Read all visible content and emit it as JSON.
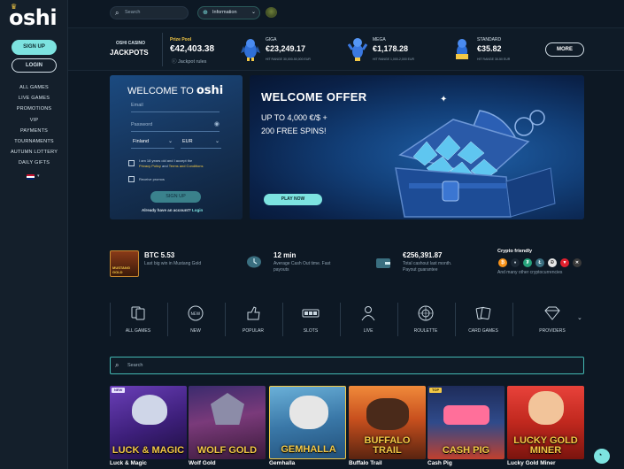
{
  "brand": {
    "logo_text": "oshi"
  },
  "sidebar": {
    "signup_label": "SIGN UP",
    "login_label": "LOGIN",
    "items": [
      {
        "label": "ALL GAMES"
      },
      {
        "label": "LIVE GAMES"
      },
      {
        "label": "PROMOTIONS"
      },
      {
        "label": "VIP"
      },
      {
        "label": "PAYMENTS"
      },
      {
        "label": "TOURNAMENTS"
      },
      {
        "label": "AUTUMN LOTTERY"
      },
      {
        "label": "DAILY GIFTS"
      }
    ],
    "language": "EN"
  },
  "topbar": {
    "search_placeholder": "Search",
    "info_label": "Information"
  },
  "jackpots": {
    "brand_line1": "OSHI CASINO",
    "brand_line2": "JACKPOTS",
    "prize_label": "Prize Pool",
    "prize_value": "€42,403.38",
    "rules_label": "Jackpot rules",
    "tiers": [
      {
        "name": "GIGA",
        "amount": "€23,249.17",
        "hit_range": "HIT RANGE 30,000-50,000 EUR"
      },
      {
        "name": "MEGA",
        "amount": "€1,178.28",
        "hit_range": "HIT RANGE 1,000-2,000 EUR"
      },
      {
        "name": "STANDARD",
        "amount": "€35.82",
        "hit_range": "HIT RANGE 30-50 EUR"
      }
    ],
    "more_label": "MORE"
  },
  "welcome_form": {
    "title": "WELCOME TO",
    "title_brand": "oshi",
    "email_placeholder": "Email",
    "password_placeholder": "Password",
    "country": "Finland",
    "currency": "EUR",
    "terms_text": "I am 18 years old and I accept the",
    "terms_link1": "Privacy Policy",
    "terms_and": "and",
    "terms_link2": "Terms and Conditions",
    "promo_text": "Receive promos",
    "signup_label": "SIGN UP",
    "have_account": "Already have an account?",
    "login_link": "Login"
  },
  "offer": {
    "heading": "WELCOME OFFER",
    "line1": "UP TO 4,000 €/$ +",
    "line2": "200 FREE SPINS!",
    "cta": "PLAY NOW"
  },
  "stats": {
    "bigwin_value": "BTC 5.53",
    "bigwin_caption": "Last big win in Mustang Gold",
    "bigwin_game": "MUSTANG GOLD",
    "cashout_value": "12 min",
    "cashout_caption_1": "Average Cash Out time. Fast",
    "cashout_caption_2": "payouts",
    "total_value": "€256,391.87",
    "total_caption_1": "Total cashout last month.",
    "total_caption_2": "Payout guarantee",
    "crypto_title": "Crypto friendly",
    "crypto_more": "And many other cryptocurrencies"
  },
  "categories": [
    {
      "label": "ALL GAMES"
    },
    {
      "label": "NEW"
    },
    {
      "label": "POPULAR"
    },
    {
      "label": "SLOTS"
    },
    {
      "label": "LIVE"
    },
    {
      "label": "ROULETTE"
    },
    {
      "label": "CARD GAMES"
    },
    {
      "label": "PROVIDERS"
    }
  ],
  "game_search_placeholder": "Search",
  "games": [
    {
      "title": "Luck & Magic",
      "art": "LUCK & MAGIC",
      "badge": "NEW"
    },
    {
      "title": "Wolf Gold",
      "art": "WOLF GOLD",
      "badge": ""
    },
    {
      "title": "Gemhalla",
      "art": "GEMHALLA",
      "badge": ""
    },
    {
      "title": "Buffalo Trail",
      "art": "BUFFALO TRAIL",
      "badge": ""
    },
    {
      "title": "Cash Pig",
      "art": "CASH PIG",
      "badge": "TOP"
    },
    {
      "title": "Lucky Gold Miner",
      "art": "LUCKY GOLD MINER",
      "badge": ""
    }
  ],
  "colors": {
    "accent": "#7de3e0",
    "gold": "#f3c845",
    "background": "#0d1824"
  }
}
